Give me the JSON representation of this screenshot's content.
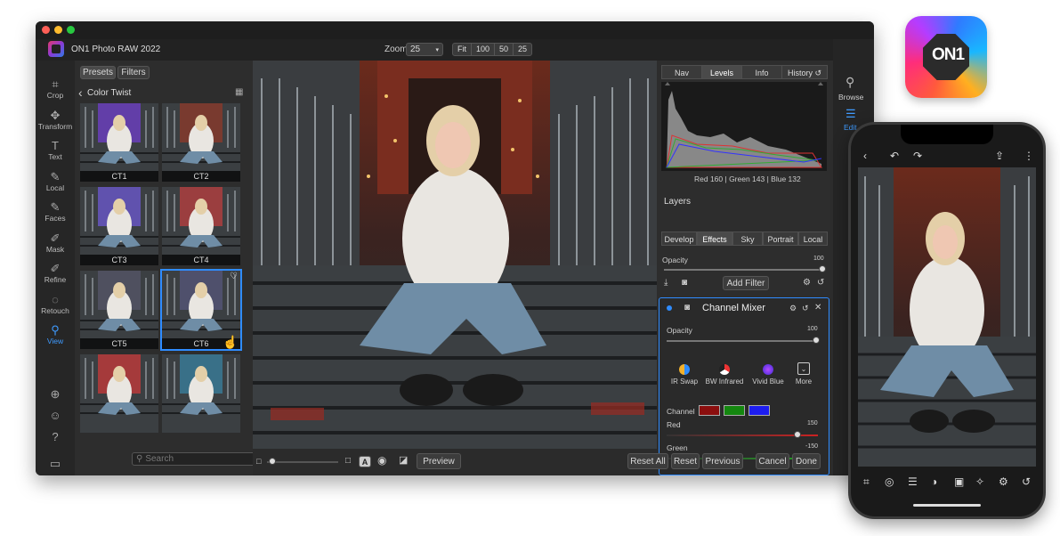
{
  "app": {
    "title": "ON1 Photo RAW 2022",
    "brand_logo_text": "ON1"
  },
  "header": {
    "zoom_label": "Zoom",
    "zoom_value": "25",
    "zoom_presets": [
      "Fit",
      "100",
      "50",
      "25"
    ]
  },
  "tools": [
    {
      "label": "Crop",
      "icon": "crop-icon"
    },
    {
      "label": "Transform",
      "icon": "move-icon"
    },
    {
      "label": "Text",
      "icon": "text-icon"
    },
    {
      "label": "Local",
      "icon": "brush-icon"
    },
    {
      "label": "Faces",
      "icon": "faces-icon"
    },
    {
      "label": "Mask",
      "icon": "mask-icon"
    },
    {
      "label": "Refine",
      "icon": "refine-icon"
    },
    {
      "label": "Retouch",
      "icon": "retouch-icon"
    },
    {
      "label": "View",
      "icon": "view-icon"
    }
  ],
  "browser": {
    "tabs": [
      "Presets",
      "Filters"
    ],
    "category": "Color Twist",
    "thumbs": [
      "CT1",
      "CT2",
      "CT3",
      "CT4",
      "CT5",
      "CT6"
    ],
    "search_placeholder": "Search"
  },
  "right_panel": {
    "tabs": [
      "Nav",
      "Levels",
      "Info",
      "History"
    ],
    "rgb_readout": "Red 160 | Green 143 | Blue 132",
    "layers_title": "Layers",
    "module_tabs": [
      "Develop",
      "Effects",
      "Sky",
      "Portrait",
      "Local"
    ],
    "opacity_label": "Opacity",
    "opacity_value": "100",
    "add_filter": "Add Filter",
    "filter": {
      "name": "Channel Mixer",
      "opacity_label": "Opacity",
      "opacity_value": "100",
      "presets": [
        "IR Swap",
        "BW Infrared",
        "Vivid Blue",
        "More"
      ],
      "channel_label": "Channel",
      "red_label": "Red",
      "red_value": "150",
      "green_label": "Green",
      "green_value": "-150"
    }
  },
  "far_right": {
    "browse": "Browse",
    "edit": "Edit"
  },
  "bottom": {
    "preview": "Preview",
    "reset_all": "Reset All",
    "reset": "Reset",
    "previous": "Previous",
    "cancel": "Cancel",
    "done": "Done",
    "badge_a": "A"
  },
  "colors": {
    "accent": "#2f8cff",
    "window_bg": "#2b2b2b"
  }
}
